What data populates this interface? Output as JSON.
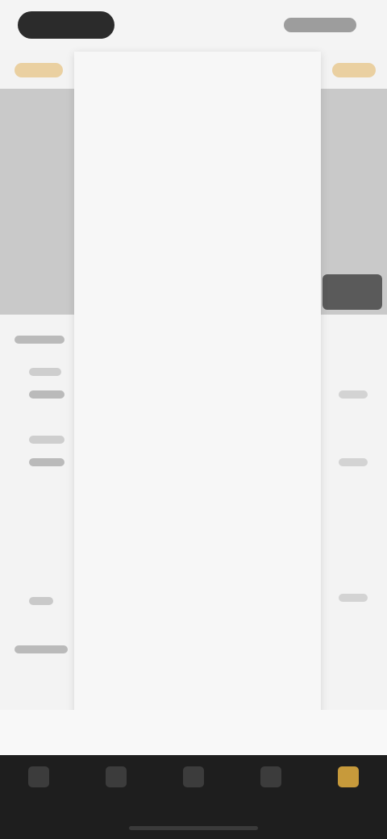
{
  "status_bar": {
    "time": "",
    "indicators": ""
  },
  "dropdown": {
    "header": "",
    "items": [
      {
        "label": ""
      },
      {
        "label": ""
      },
      {
        "label": ""
      },
      {
        "label": ""
      },
      {
        "label": ""
      },
      {
        "label": ""
      },
      {
        "label": ""
      },
      {
        "label": ""
      },
      {
        "label": ""
      },
      {
        "label": ""
      },
      {
        "label": ""
      },
      {
        "label": ""
      },
      {
        "label": ""
      },
      {
        "label": ""
      },
      {
        "label": ""
      },
      {
        "label": ""
      },
      {
        "label": ""
      }
    ]
  },
  "tab_bar": {
    "tabs": [
      {
        "icon": "home-icon",
        "label": "",
        "active": false
      },
      {
        "icon": "grid-icon",
        "label": "",
        "active": false
      },
      {
        "icon": "chart-icon",
        "label": "",
        "active": false
      },
      {
        "icon": "wallet-icon",
        "label": "",
        "active": false
      },
      {
        "icon": "profile-icon",
        "label": "",
        "active": true
      }
    ]
  },
  "colors": {
    "accent": "#c79a3b",
    "tab_bar_bg": "#1e1e1e",
    "menu_bg": "#f7f7f7"
  }
}
